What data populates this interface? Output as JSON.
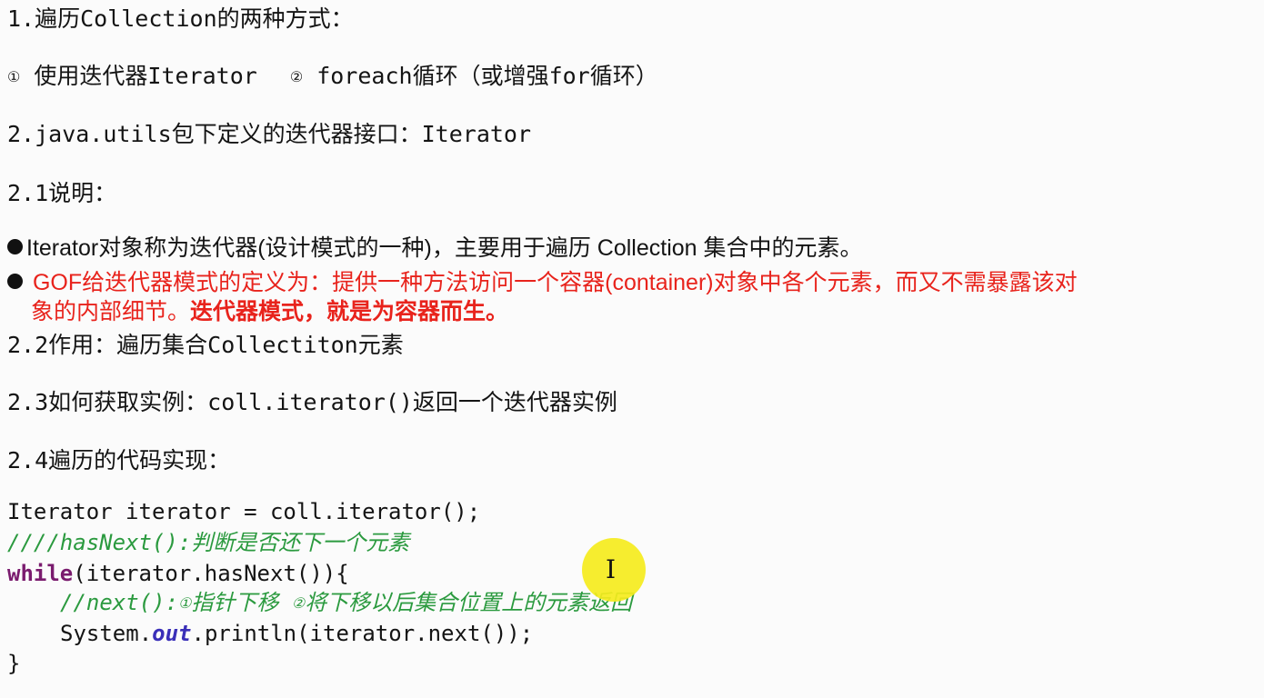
{
  "lines": {
    "l1": "1.遍历Collection的两种方式：",
    "l2a": "①",
    "l2b": " 使用迭代器Iterator",
    "l2c": "②",
    "l2d": " foreach循环（或增强for循环）",
    "l3": "2.java.utils包下定义的迭代器接口：Iterator",
    "l4": "2.1说明：",
    "b1": "Iterator对象称为迭代器(设计模式的一种)，主要用于遍历 Collection 集合中的元素。",
    "b2a": "GOF给迭代器模式的定义为：提供一种方法访问一个容器(container)对象中各个元素，而又不需暴露该对",
    "b2b": "象的内部细节。",
    "b2c": "迭代器模式，就是为容器而生。",
    "l5": "2.2作用：遍历集合Collectiton元素",
    "l6": "2.3如何获取实例：coll.iterator()返回一个迭代器实例",
    "l7": "2.4遍历的代码实现："
  },
  "code": {
    "c1": "Iterator iterator = coll.iterator();",
    "c2": "////hasNext():判断是否还下一个元素",
    "c3kw": "while",
    "c3": "(iterator.hasNext()){",
    "c4a": "//next():",
    "c4b": "①",
    "c4c": "指针下移 ",
    "c4d": "②",
    "c4e": "将下移以后集合位置上的元素返回",
    "c5a": "System.",
    "c5b": "out",
    "c5c": ".println(iterator.next());",
    "c6": "}"
  },
  "cursor": {
    "icon": "text-cursor-icon",
    "highlight": "#f5ec1d",
    "glyph": "I"
  }
}
